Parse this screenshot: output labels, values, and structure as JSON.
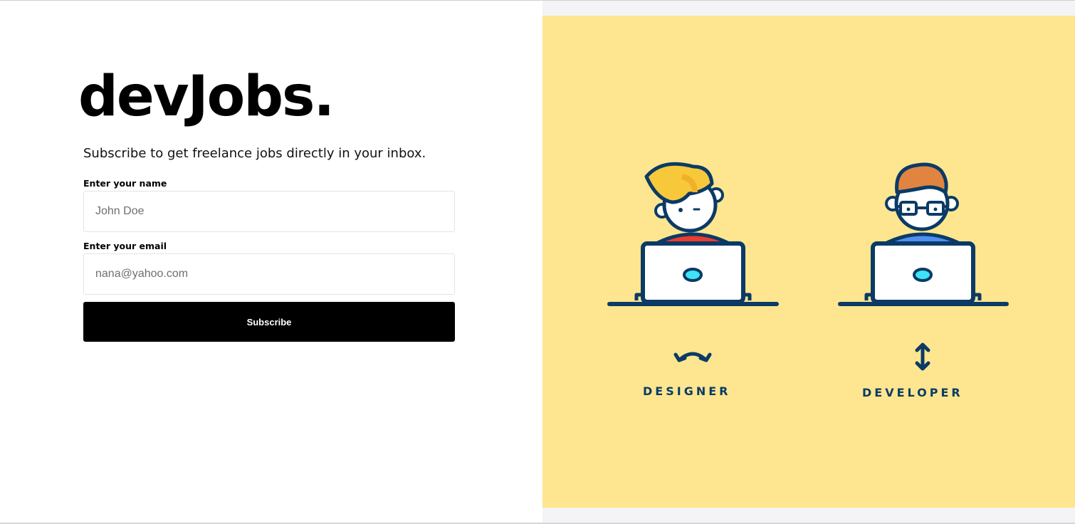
{
  "brand": {
    "title": "devJobs."
  },
  "tagline": "Subscribe to get freelance jobs directly in your inbox.",
  "form": {
    "name_label": "Enter your name",
    "name_placeholder": "John Doe",
    "email_label": "Enter your email",
    "email_placeholder": "nana@yahoo.com",
    "submit_label": "Subscribe"
  },
  "illustration": {
    "background_color": "#fde68f",
    "outline_color": "#0b3a66",
    "roles": [
      {
        "label": "DESIGNER",
        "icon": "swap-horizontal-icon",
        "hair_color": "#f6c83a",
        "shirt_color": "#ee3b2e"
      },
      {
        "label": "DEVELOPER",
        "icon": "swap-vertical-icon",
        "hair_color": "#e0843f",
        "shirt_color": "#4f8ff2"
      }
    ]
  }
}
